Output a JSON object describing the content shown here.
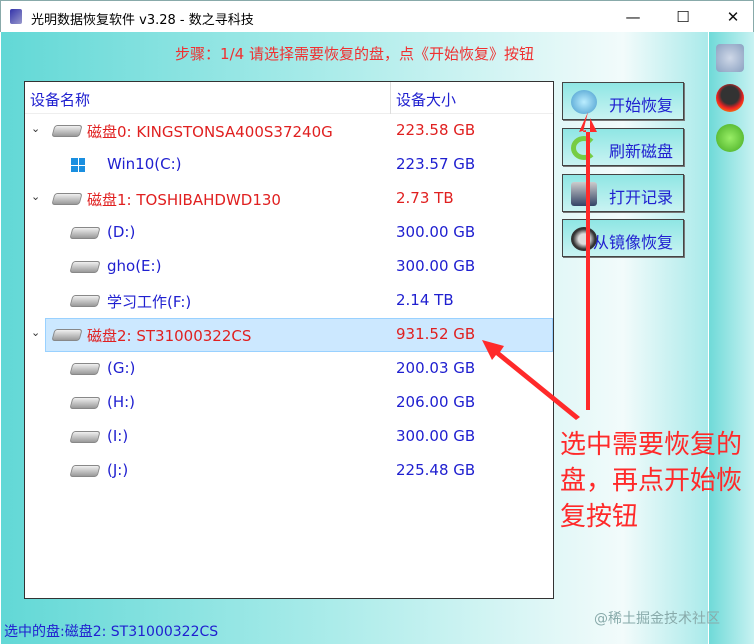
{
  "window": {
    "title": "光明数据恢复软件 v3.28 - 数之寻科技",
    "minimize": "—",
    "maximize": "☐",
    "close": "✕"
  },
  "step": "步骤：1/4 请选择需要恢复的盘，点《开始恢复》按钮",
  "list": {
    "col_name": "设备名称",
    "col_size": "设备大小",
    "rows": [
      {
        "name": "磁盘0: KINGSTONSA400S37240G",
        "size": "223.58 GB"
      },
      {
        "name": "Win10(C:)",
        "size": "223.57 GB"
      },
      {
        "name": "磁盘1: TOSHIBAHDWD130",
        "size": "2.73 TB"
      },
      {
        "name": "(D:)",
        "size": "300.00 GB"
      },
      {
        "name": "gho(E:)",
        "size": "300.00 GB"
      },
      {
        "name": "学习工作(F:)",
        "size": "2.14 TB"
      },
      {
        "name": "磁盘2: ST31000322CS",
        "size": "931.52 GB"
      },
      {
        "name": "(G:)",
        "size": "200.03 GB"
      },
      {
        "name": "(H:)",
        "size": "206.00 GB"
      },
      {
        "name": "(I:)",
        "size": "300.00 GB"
      },
      {
        "name": "(J:)",
        "size": "225.48 GB"
      }
    ]
  },
  "buttons": {
    "start": "开始恢复",
    "refresh": "刷新磁盘",
    "open_log": "打开记录",
    "from_image": "从镜像恢复"
  },
  "annotation": "选中需要恢复的盘，再点开始恢复按钮",
  "status": "选中的盘:磁盘2: ST31000322CS",
  "watermark": "@稀土掘金技术社区"
}
